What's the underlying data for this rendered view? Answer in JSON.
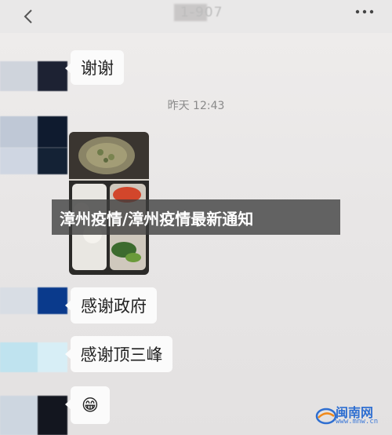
{
  "header": {
    "back_icon": "chevron-left-icon",
    "title_partial": "1-907",
    "more_icon": "more-dots-icon"
  },
  "messages": [
    {
      "text": "谢谢"
    },
    {
      "timestamp": "昨天 12:43"
    },
    {
      "type": "image",
      "description_icon": "food-photo"
    },
    {
      "text": "感谢政府"
    },
    {
      "text": "感谢顶三峰"
    },
    {
      "emoji": "😁"
    }
  ],
  "overlay": {
    "caption": "漳州​疫情/漳州疫情最新通知"
  },
  "watermark": {
    "name": "闽南网",
    "url": "www.mnw.cn"
  },
  "colors": {
    "background": "#eceaea",
    "bubble": "#fbfbfb",
    "caption_band": "#3c3c3c",
    "watermark_blue": "#2f6fd1"
  }
}
